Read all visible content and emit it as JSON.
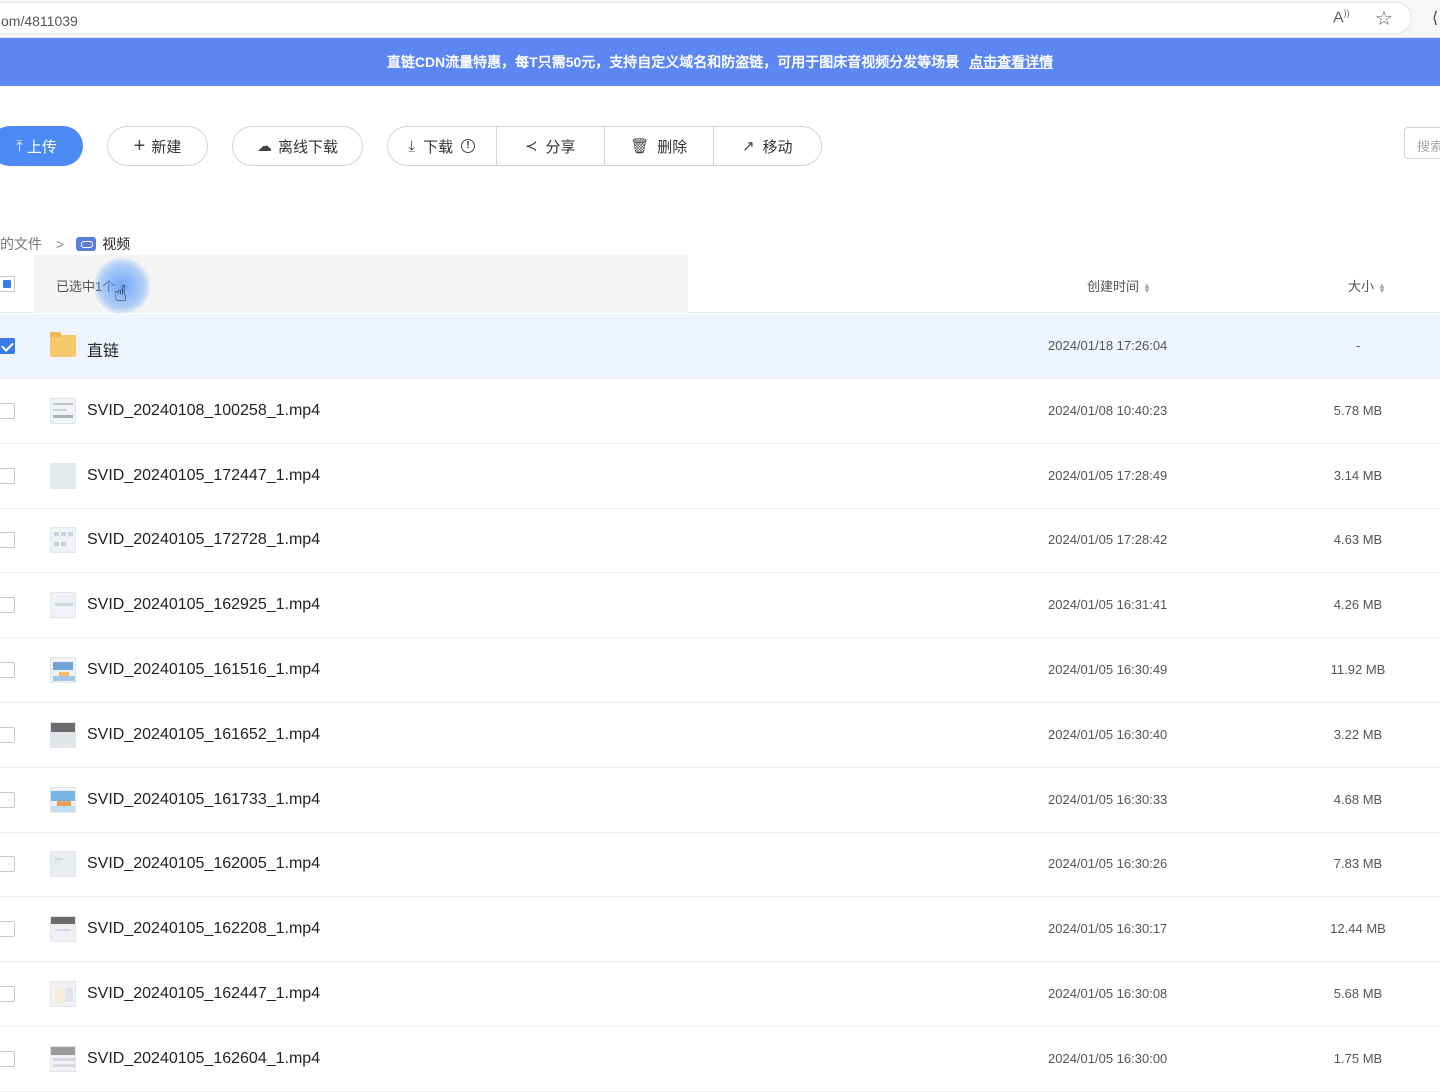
{
  "browser": {
    "url": "om/4811039",
    "read_aloud_icon": "read-aloud-icon",
    "favorite_icon": "star-icon"
  },
  "banner": {
    "text": "直链CDN流量特惠，每T只需50元，支持自定义域名和防盗链，可用于图床音视频分发等场景",
    "link": "点击查看详情",
    "color": "#5c86f2"
  },
  "toolbar": {
    "upload": "上传",
    "new": "新建",
    "offline_download": "离线下载",
    "download": "下载",
    "share": "分享",
    "delete": "删除",
    "move": "移动",
    "search_placeholder": "搜索"
  },
  "breadcrumb": {
    "parent": "的文件",
    "separator": ">",
    "current": "视频"
  },
  "list_header": {
    "selected": "已选中1个",
    "created": "创建时间",
    "size": "大小"
  },
  "files": [
    {
      "name": "直链",
      "created": "2024/01/18 17:26:04",
      "size": "-",
      "type": "folder",
      "checked": true
    },
    {
      "name": "SVID_20240108_100258_1.mp4",
      "created": "2024/01/08 10:40:23",
      "size": "5.78 MB",
      "type": "video",
      "checked": false
    },
    {
      "name": "SVID_20240105_172447_1.mp4",
      "created": "2024/01/05 17:28:49",
      "size": "3.14 MB",
      "type": "video",
      "checked": false
    },
    {
      "name": "SVID_20240105_172728_1.mp4",
      "created": "2024/01/05 17:28:42",
      "size": "4.63 MB",
      "type": "video",
      "checked": false
    },
    {
      "name": "SVID_20240105_162925_1.mp4",
      "created": "2024/01/05 16:31:41",
      "size": "4.26 MB",
      "type": "video",
      "checked": false
    },
    {
      "name": "SVID_20240105_161516_1.mp4",
      "created": "2024/01/05 16:30:49",
      "size": "11.92 MB",
      "type": "video",
      "checked": false
    },
    {
      "name": "SVID_20240105_161652_1.mp4",
      "created": "2024/01/05 16:30:40",
      "size": "3.22 MB",
      "type": "video",
      "checked": false
    },
    {
      "name": "SVID_20240105_161733_1.mp4",
      "created": "2024/01/05 16:30:33",
      "size": "4.68 MB",
      "type": "video",
      "checked": false
    },
    {
      "name": "SVID_20240105_162005_1.mp4",
      "created": "2024/01/05 16:30:26",
      "size": "7.83 MB",
      "type": "video",
      "checked": false
    },
    {
      "name": "SVID_20240105_162208_1.mp4",
      "created": "2024/01/05 16:30:17",
      "size": "12.44 MB",
      "type": "video",
      "checked": false
    },
    {
      "name": "SVID_20240105_162447_1.mp4",
      "created": "2024/01/05 16:30:08",
      "size": "5.68 MB",
      "type": "video",
      "checked": false
    },
    {
      "name": "SVID_20240105_162604_1.mp4",
      "created": "2024/01/05 16:30:00",
      "size": "1.75 MB",
      "type": "video",
      "checked": false
    }
  ]
}
